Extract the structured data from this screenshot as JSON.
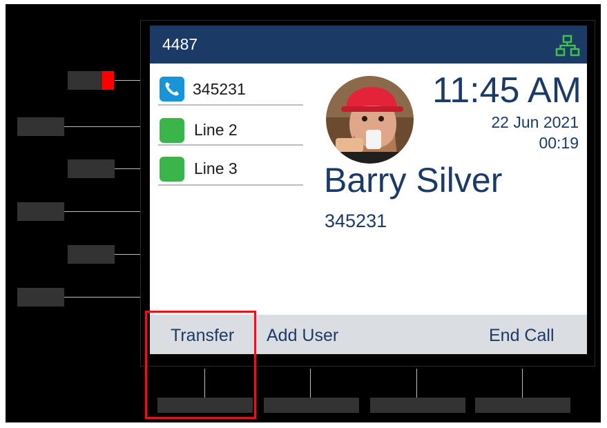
{
  "status_bar": {
    "extension": "4487",
    "network_icon": "network-icon",
    "color": "#1b3a66"
  },
  "lines": [
    {
      "label": "345231",
      "icon": "phone-icon",
      "badge_color": "#1a94d9",
      "active": true
    },
    {
      "label": "Line 2",
      "icon": "line-key",
      "badge_color": "#3ab54a",
      "active": false
    },
    {
      "label": "Line 3",
      "icon": "line-key",
      "badge_color": "#3ab54a",
      "active": false
    }
  ],
  "call": {
    "time": "11:45 AM",
    "date": "22 Jun 2021",
    "duration": "00:19",
    "caller_name": "Barry Silver",
    "caller_number": "345231",
    "avatar": "caller-avatar"
  },
  "softkeys": [
    {
      "label": "Transfer",
      "highlighted": true
    },
    {
      "label": "Add User",
      "highlighted": false
    },
    {
      "label": "",
      "highlighted": false
    },
    {
      "label": "End Call",
      "highlighted": false
    }
  ],
  "colors": {
    "accent": "#1b3a66",
    "led": "#ff0000",
    "highlight": "#e8141c"
  }
}
